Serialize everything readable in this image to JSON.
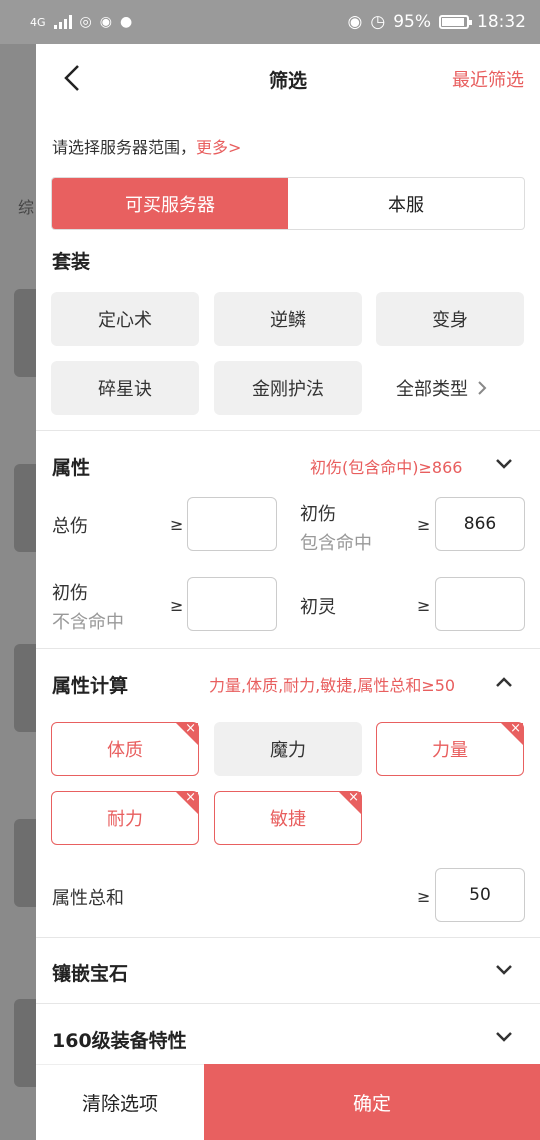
{
  "status_bar": {
    "network": "4G",
    "battery": "95%",
    "time": "18:32"
  },
  "background": {
    "tab_hint": "综"
  },
  "header": {
    "title": "筛选",
    "recent_label": "最近筛选"
  },
  "server_range": {
    "hint": "请选择服务器范围，",
    "more": "更多>",
    "options": [
      "可买服务器",
      "本服"
    ],
    "selected_index": 0
  },
  "suit": {
    "title": "套装",
    "chips": [
      "定心术",
      "逆鳞",
      "变身",
      "碎星诀",
      "金刚护法"
    ],
    "all_types": "全部类型"
  },
  "attributes": {
    "title": "属性",
    "summary": "初伤(包含命中)≥866",
    "fields": [
      {
        "label": "总伤",
        "sub": "",
        "op": "≥",
        "value": ""
      },
      {
        "label": "初伤",
        "sub": "包含命中",
        "op": "≥",
        "value": "866"
      },
      {
        "label": "初伤",
        "sub": "不含命中",
        "op": "≥",
        "value": ""
      },
      {
        "label": "初灵",
        "sub": "",
        "op": "≥",
        "value": ""
      }
    ]
  },
  "calc": {
    "title": "属性计算",
    "summary": "力量,体质,耐力,敏捷,属性总和≥50",
    "chips": [
      {
        "label": "体质",
        "selected": true
      },
      {
        "label": "魔力",
        "selected": false
      },
      {
        "label": "力量",
        "selected": true
      },
      {
        "label": "耐力",
        "selected": true
      },
      {
        "label": "敏捷",
        "selected": true
      }
    ],
    "close_mark": "×",
    "total_label": "属性总和",
    "total_op": "≥",
    "total_value": "50"
  },
  "gem": {
    "title": "镶嵌宝石"
  },
  "feature": {
    "title": "160级装备特性"
  },
  "footer": {
    "clear_label": "清除选项",
    "confirm_label": "确定"
  },
  "colors": {
    "accent": "#e86060",
    "accent_text": "#e85e5e"
  }
}
